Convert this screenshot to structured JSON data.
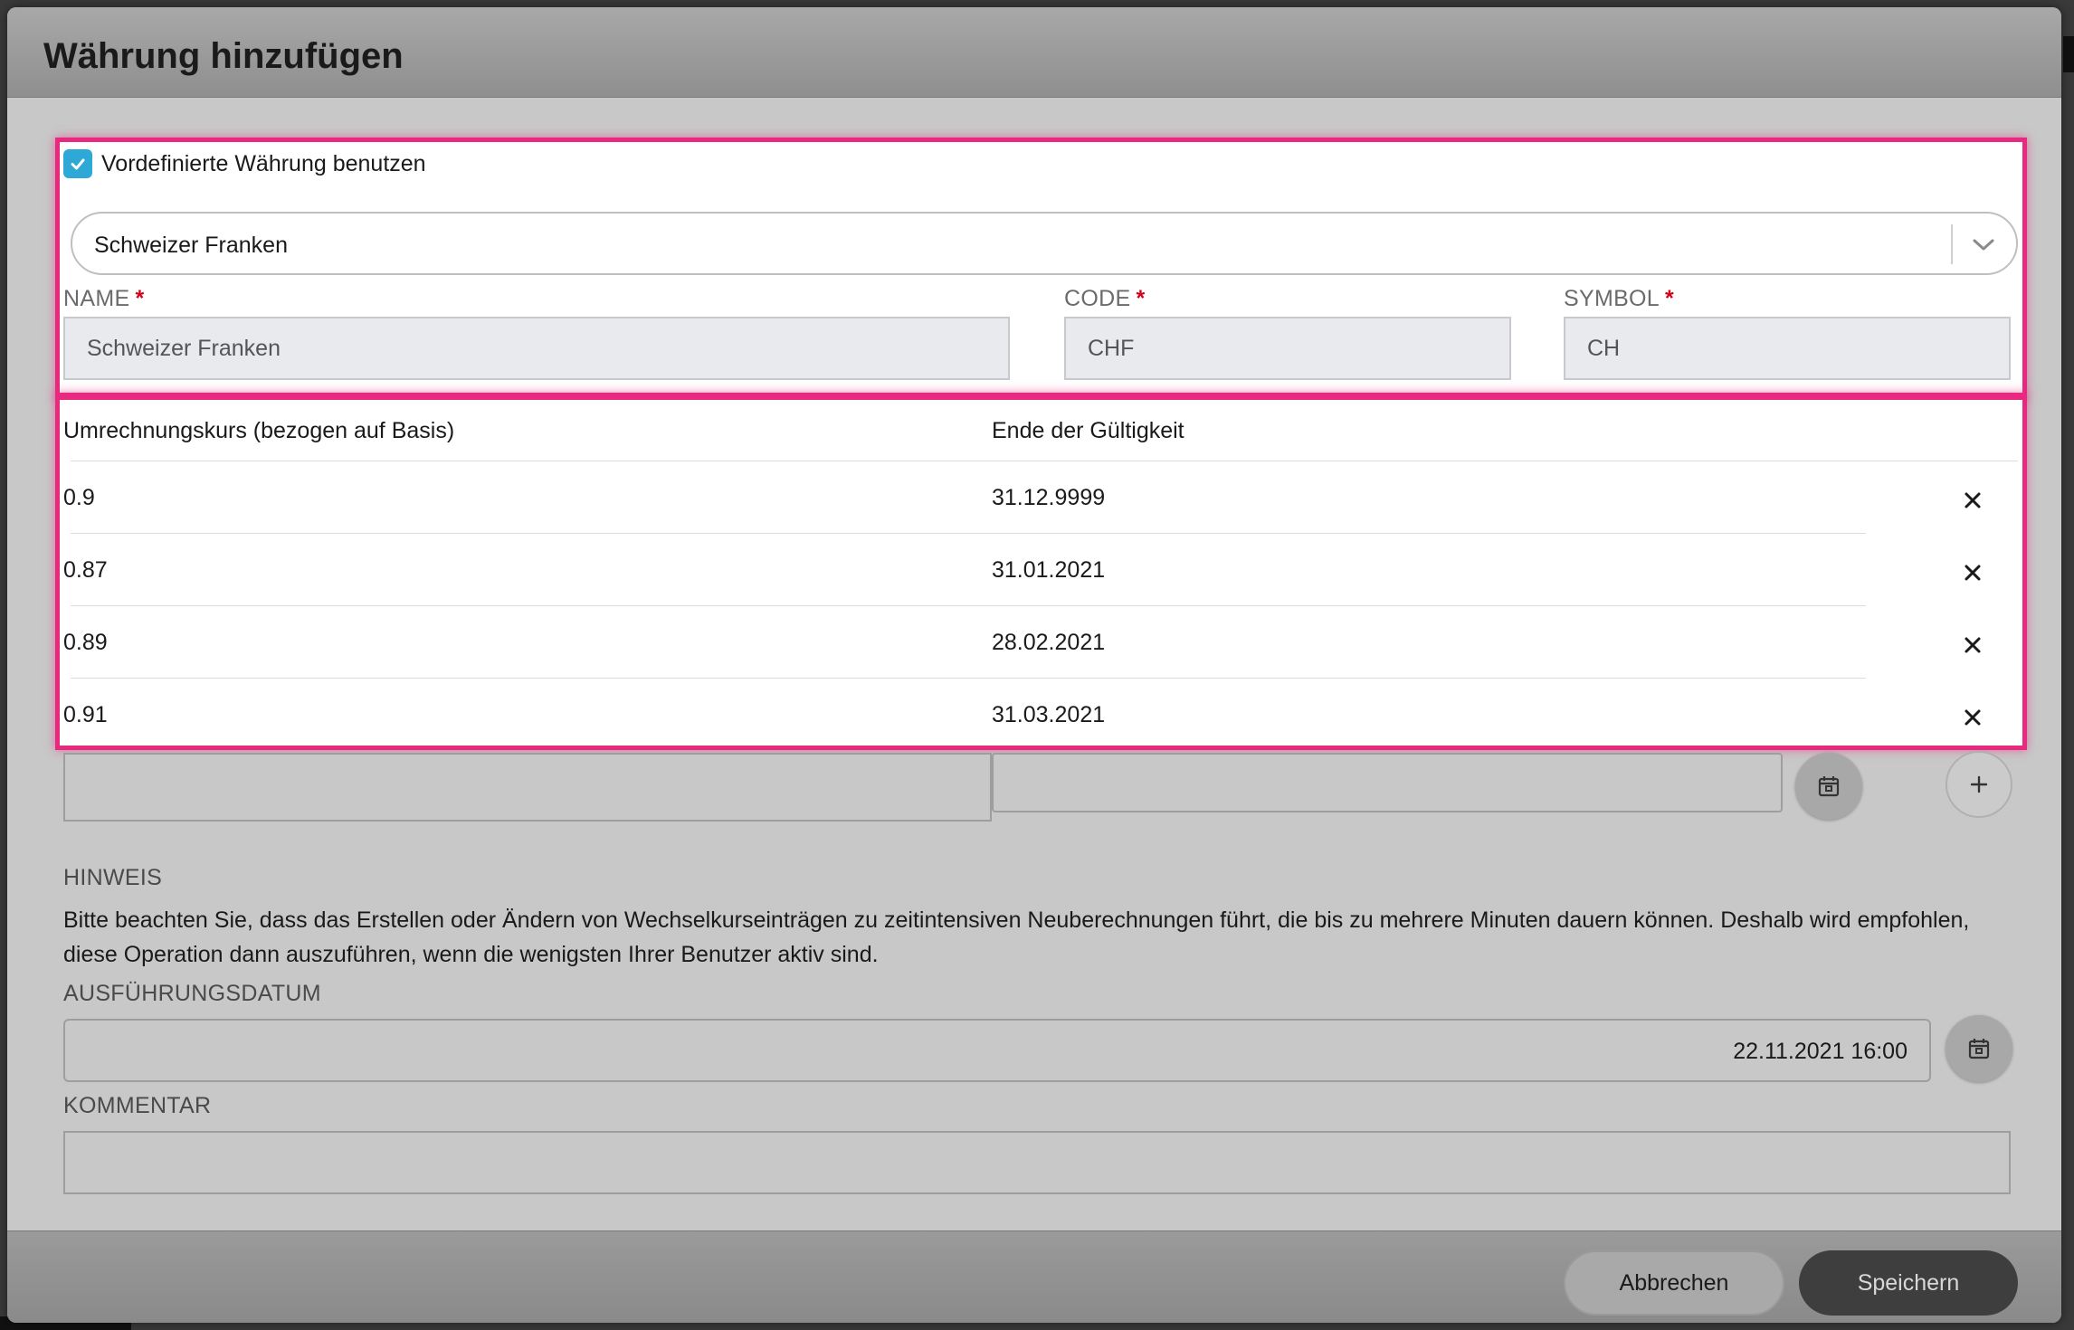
{
  "dialog": {
    "title": "Währung hinzufügen"
  },
  "predefined": {
    "checkbox_label": "Vordefinierte Währung benutzen",
    "checked": true,
    "selected_currency": "Schweizer Franken"
  },
  "fields": {
    "name": {
      "label": "NAME",
      "required_mark": "*",
      "value": "Schweizer Franken"
    },
    "code": {
      "label": "CODE",
      "required_mark": "*",
      "value": "CHF"
    },
    "symbol": {
      "label": "SYMBOL",
      "required_mark": "*",
      "value": "CH"
    }
  },
  "rates_table": {
    "columns": [
      "Umrechnungskurs (bezogen auf Basis)",
      "Ende der Gültigkeit"
    ],
    "rows": [
      {
        "rate": "0.9",
        "valid_until": "31.12.9999"
      },
      {
        "rate": "0.87",
        "valid_until": "31.01.2021"
      },
      {
        "rate": "0.89",
        "valid_until": "28.02.2021"
      },
      {
        "rate": "0.91",
        "valid_until": "31.03.2021"
      }
    ]
  },
  "note": {
    "label": "HINWEIS",
    "text": "Bitte beachten Sie, dass das Erstellen oder Ändern von Wechselkurseinträgen zu zeitintensiven Neuberechnungen führt, die bis zu mehrere Minuten dauern können. Deshalb wird empfohlen, diese Operation dann auszuführen, wenn die wenigsten Ihrer Benutzer aktiv sind."
  },
  "execution_date": {
    "label": "AUSFÜHRUNGSDATUM",
    "value": "22.11.2021 16:00"
  },
  "comment": {
    "label": "KOMMENTAR",
    "value": ""
  },
  "footer": {
    "cancel_label": "Abbrechen",
    "save_label": "Speichern"
  },
  "colors": {
    "highlight": "#e8297f",
    "checkbox": "#2ea8d6",
    "required": "#d0021b"
  }
}
